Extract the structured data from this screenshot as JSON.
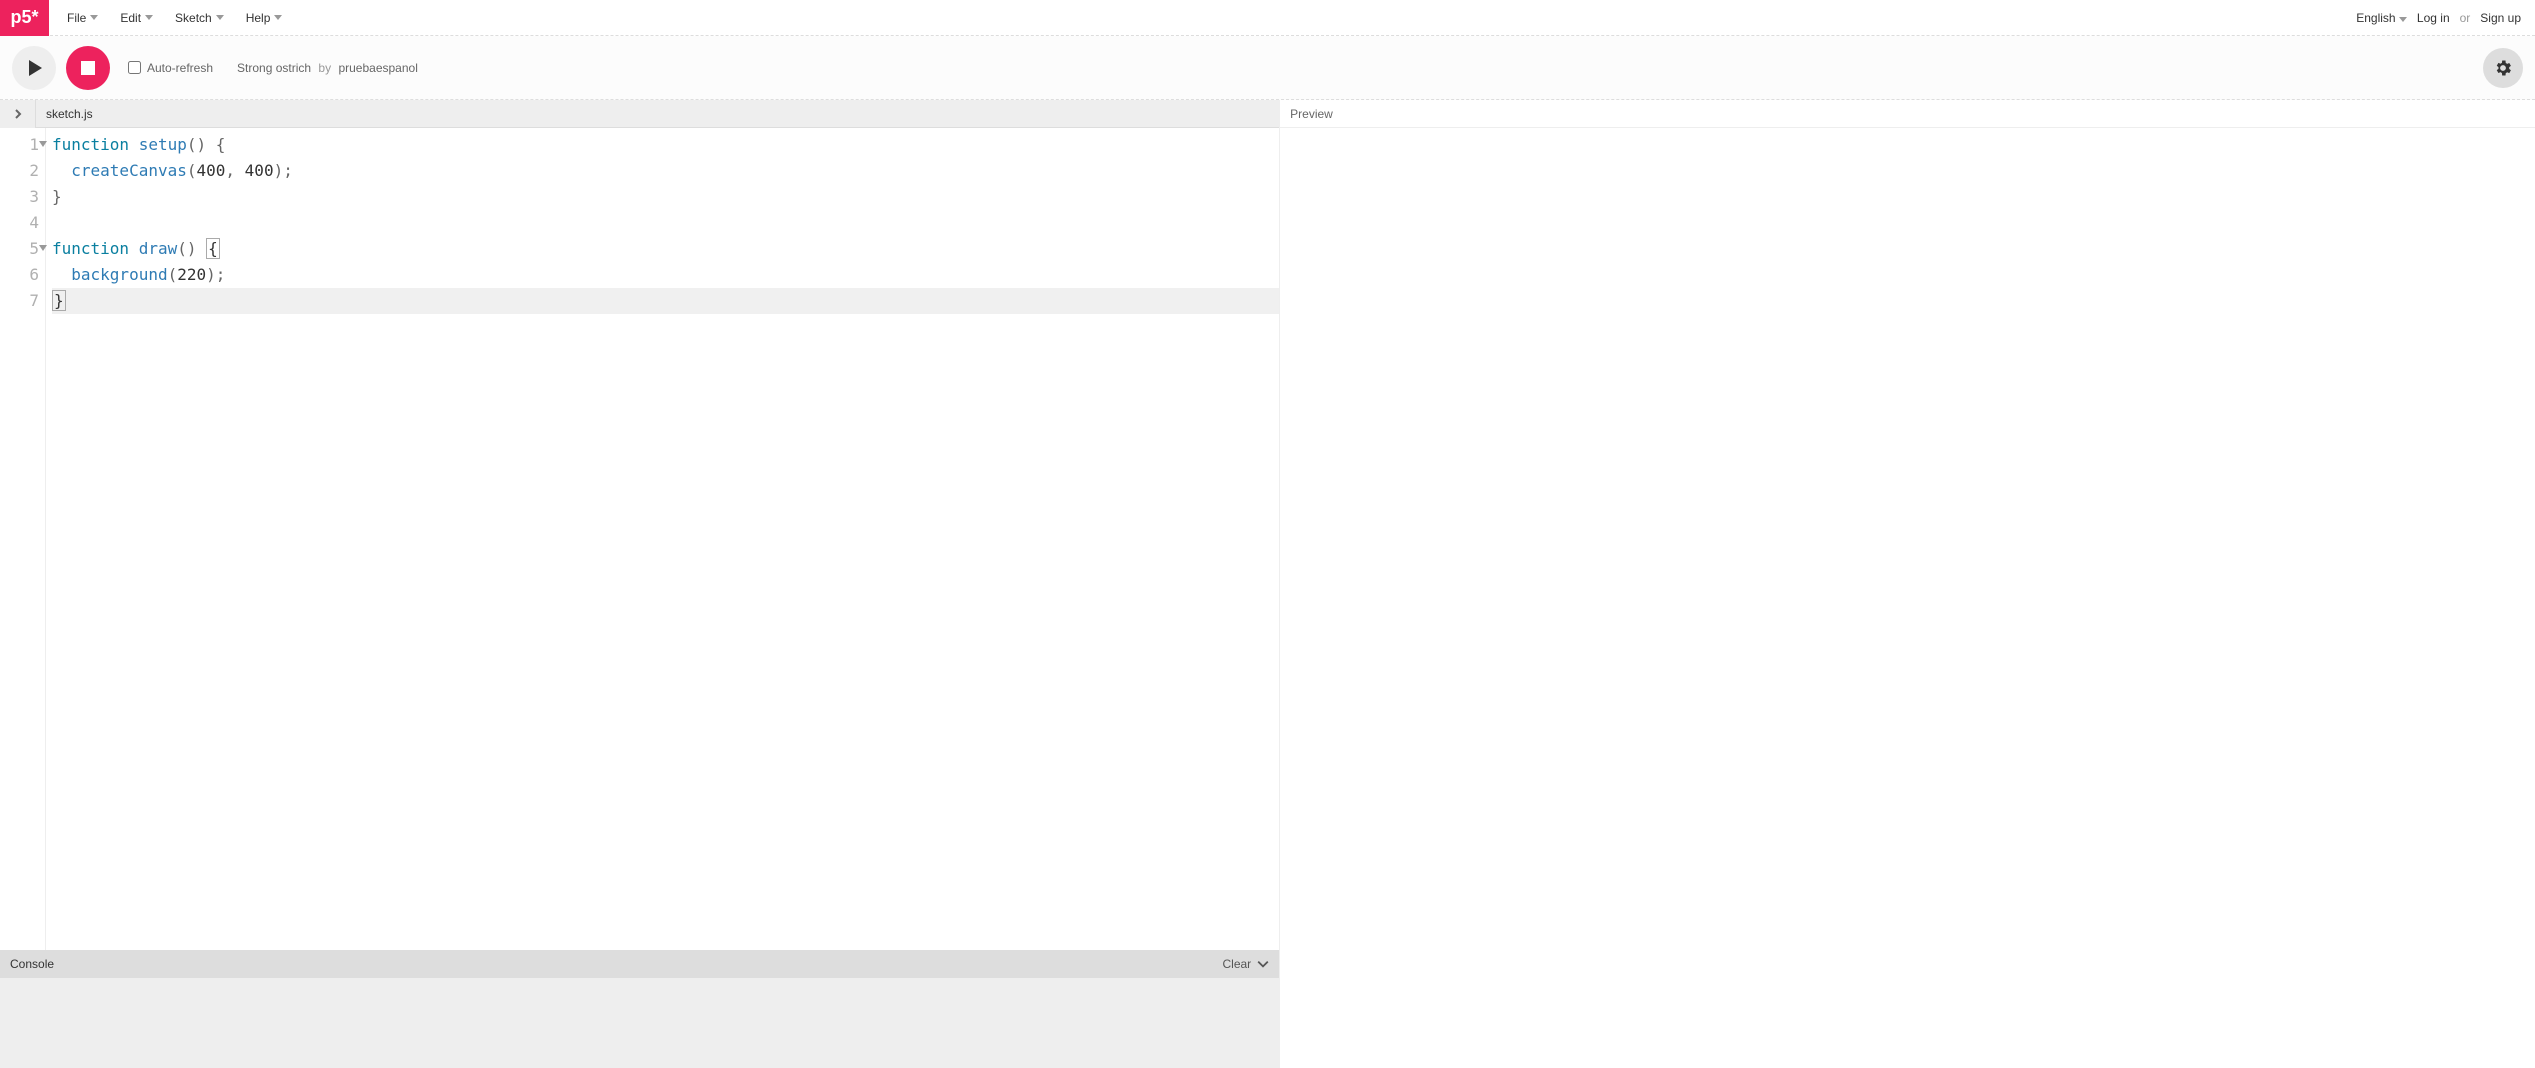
{
  "nav": {
    "logo": "p5*",
    "menus": [
      "File",
      "Edit",
      "Sketch",
      "Help"
    ],
    "language": "English",
    "login": "Log in",
    "or": "or",
    "signup": "Sign up"
  },
  "toolbar": {
    "autorefresh_label": "Auto-refresh",
    "sketch_name": "Strong ostrich",
    "by": "by",
    "author": "pruebaespanol"
  },
  "editor": {
    "filename": "sketch.js",
    "lines": [
      {
        "n": 1,
        "fold": true,
        "tokens": [
          [
            "kw",
            "function "
          ],
          [
            "fn",
            "setup"
          ],
          [
            "pn",
            "() {"
          ]
        ]
      },
      {
        "n": 2,
        "fold": false,
        "tokens": [
          [
            "pn",
            "  "
          ],
          [
            "fn",
            "createCanvas"
          ],
          [
            "pn",
            "("
          ],
          [
            "num",
            "400"
          ],
          [
            "pn",
            ", "
          ],
          [
            "num",
            "400"
          ],
          [
            "pn",
            ");"
          ]
        ]
      },
      {
        "n": 3,
        "fold": false,
        "tokens": [
          [
            "pn",
            "}"
          ]
        ]
      },
      {
        "n": 4,
        "fold": false,
        "tokens": []
      },
      {
        "n": 5,
        "fold": true,
        "tokens": [
          [
            "kw",
            "function "
          ],
          [
            "fn",
            "draw"
          ],
          [
            "pn",
            "() "
          ],
          [
            "bracket-match",
            "{"
          ]
        ]
      },
      {
        "n": 6,
        "fold": false,
        "tokens": [
          [
            "pn",
            "  "
          ],
          [
            "fn",
            "background"
          ],
          [
            "pn",
            "("
          ],
          [
            "num",
            "220"
          ],
          [
            "pn",
            ");"
          ]
        ]
      },
      {
        "n": 7,
        "fold": false,
        "hl": true,
        "tokens": [
          [
            "bracket-match",
            "}"
          ]
        ]
      }
    ]
  },
  "preview": {
    "label": "Preview"
  },
  "console": {
    "label": "Console",
    "clear": "Clear"
  }
}
